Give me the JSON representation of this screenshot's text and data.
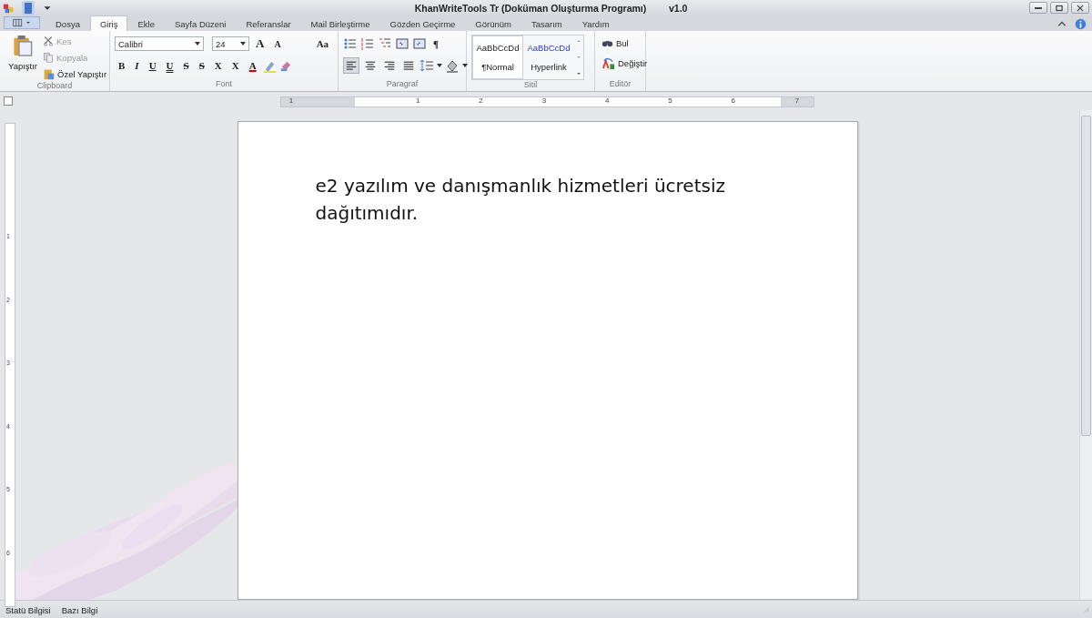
{
  "window": {
    "title": "KhanWriteTools Tr (Doküman Oluşturma Programı)",
    "version": "v1.0"
  },
  "tabs": [
    {
      "label": "Dosya",
      "selected": false
    },
    {
      "label": "Giriş",
      "selected": true
    },
    {
      "label": "Ekle",
      "selected": false
    },
    {
      "label": "Sayfa Düzeni",
      "selected": false
    },
    {
      "label": "Referanslar",
      "selected": false
    },
    {
      "label": "Mail Birleştirme",
      "selected": false
    },
    {
      "label": "Gözden Geçirme",
      "selected": false
    },
    {
      "label": "Görünüm",
      "selected": false
    },
    {
      "label": "Tasarım",
      "selected": false
    },
    {
      "label": "Yardım",
      "selected": false
    }
  ],
  "clipboard": {
    "group": "Clipboard",
    "paste": "Yapıştır",
    "items": [
      {
        "label": "Kes",
        "kind": "cut",
        "disabled": true
      },
      {
        "label": "Kopyala",
        "kind": "copy",
        "disabled": true
      },
      {
        "label": "Özel Yapıştır",
        "kind": "special",
        "disabled": false
      }
    ]
  },
  "font": {
    "group": "Font",
    "family": "Calibri",
    "size": "24",
    "case_button": "Aa",
    "grow": "A",
    "shrink": "A",
    "format_buttons": [
      {
        "label": "B",
        "kind": "bold"
      },
      {
        "label": "I",
        "kind": "italic"
      },
      {
        "label": "U",
        "kind": "underline"
      },
      {
        "label": "U",
        "kind": "double"
      },
      {
        "label": "S",
        "kind": "strike"
      },
      {
        "label": "S",
        "kind": "strike2"
      },
      {
        "label": "X",
        "kind": "sup"
      },
      {
        "label": "X",
        "kind": "sub"
      }
    ],
    "color_button": "A"
  },
  "paragraph": {
    "group": "Paragraf",
    "pilcrow": "¶",
    "alignments": [
      {
        "kind": "left",
        "selected": true
      },
      {
        "kind": "center",
        "selected": false
      },
      {
        "kind": "right",
        "selected": false
      },
      {
        "kind": "justify",
        "selected": false
      }
    ]
  },
  "styles": {
    "group": "Sitil",
    "items": [
      {
        "sample": "AaBbCcDd",
        "label": "¶Normal",
        "kind": "normal",
        "selected": true
      },
      {
        "sample": "AaBbCcDd",
        "label": "Hyperlink",
        "kind": "link",
        "selected": false
      }
    ]
  },
  "editor": {
    "group": "Editör",
    "items": [
      {
        "label": "Bul",
        "kind": "find"
      },
      {
        "label": "Değiştir",
        "kind": "replace"
      }
    ]
  },
  "ruler": {
    "left_label": "1",
    "labels": [
      "1",
      "2",
      "3",
      "4",
      "5",
      "6"
    ],
    "right_label": "7"
  },
  "vertical_ruler": {
    "labels": [
      "1",
      "2",
      "3",
      "4",
      "5",
      "6"
    ]
  },
  "document": {
    "text": "e2 yazılım ve danışmanlık hizmetleri ücretsiz dağıtımıdır."
  },
  "status_bar": [
    "Statü Bilgisi",
    "Bazı Bilgi"
  ]
}
